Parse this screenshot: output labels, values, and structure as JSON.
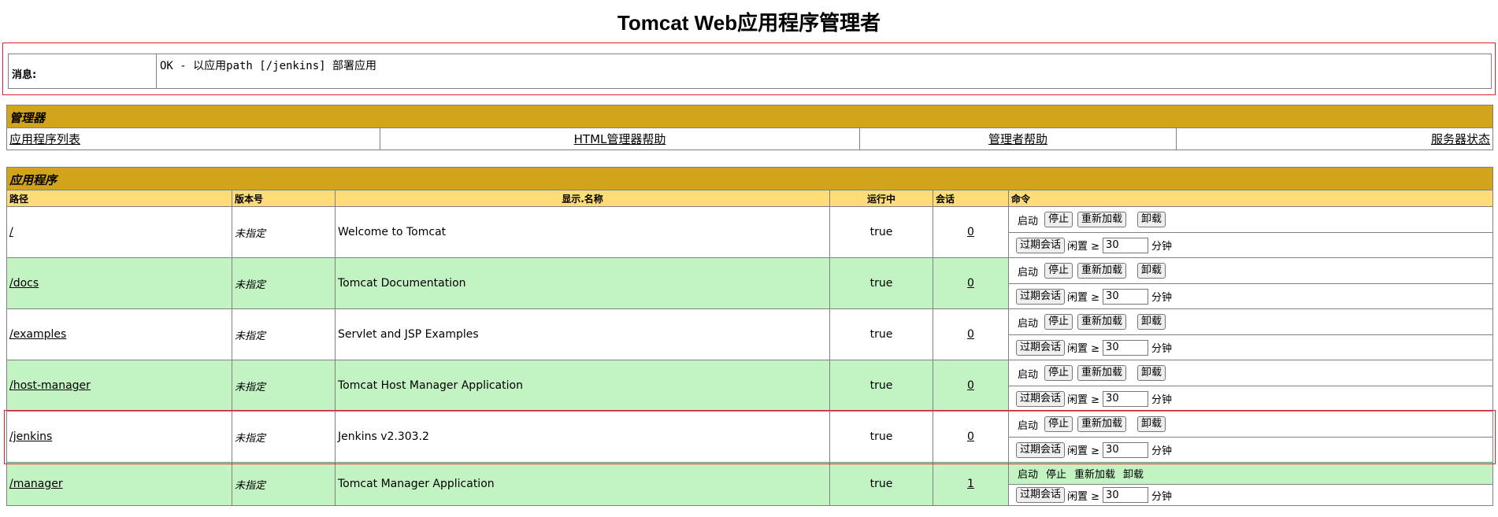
{
  "page": {
    "title": "Tomcat Web应用程序管理者"
  },
  "message": {
    "label": "消息:",
    "text": "OK - 以应用path [/jenkins] 部署应用"
  },
  "manager": {
    "header": "管理器",
    "links": [
      "应用程序列表",
      "HTML管理器帮助",
      "管理者帮助",
      "服务器状态"
    ]
  },
  "applications": {
    "header": "应用程序",
    "columns": [
      "路径",
      "版本号",
      "显示.名称",
      "运行中",
      "会话",
      "命令"
    ],
    "commands": {
      "start": "启动",
      "stop": "停止",
      "reload": "重新加载",
      "undeploy": "卸载",
      "expire": "过期会话",
      "idle": "闲置 ≥",
      "minutes": "分钟"
    },
    "rows": [
      {
        "path": "/",
        "version": "未指定",
        "name": "Welcome to Tomcat",
        "running": "true",
        "sessions": "0",
        "idle_value": "30"
      },
      {
        "path": "/docs",
        "version": "未指定",
        "name": "Tomcat Documentation",
        "running": "true",
        "sessions": "0",
        "idle_value": "30"
      },
      {
        "path": "/examples",
        "version": "未指定",
        "name": "Servlet and JSP Examples",
        "running": "true",
        "sessions": "0",
        "idle_value": "30"
      },
      {
        "path": "/host-manager",
        "version": "未指定",
        "name": "Tomcat Host Manager Application",
        "running": "true",
        "sessions": "0",
        "idle_value": "30"
      },
      {
        "path": "/jenkins",
        "version": "未指定",
        "name": "Jenkins v2.303.2",
        "running": "true",
        "sessions": "0",
        "idle_value": "30"
      },
      {
        "path": "/manager",
        "version": "未指定",
        "name": "Tomcat Manager Application",
        "running": "true",
        "sessions": "1",
        "idle_value": "30"
      }
    ]
  },
  "colors": {
    "section_header": "#d2a41c",
    "column_header": "#ffdc75",
    "row_shade": "#c3f3c3",
    "highlight": "#e0202a"
  }
}
